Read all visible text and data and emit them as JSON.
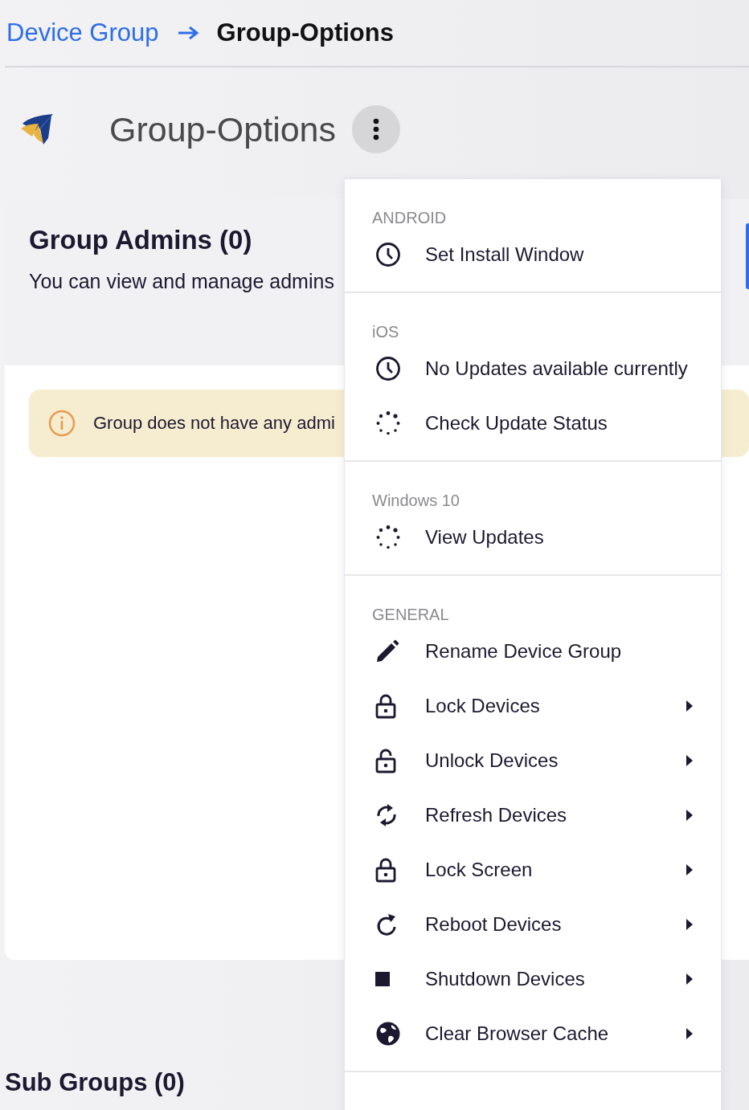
{
  "breadcrumb": {
    "parent": "Device Group",
    "current": "Group-Options"
  },
  "header": {
    "title": "Group-Options"
  },
  "admins_card": {
    "title": "Group Admins (0)",
    "description": "You can view and manage admins",
    "alert": "Group does not have any admi"
  },
  "sub_groups": {
    "title": "Sub Groups (0)"
  },
  "menu": {
    "sections": [
      {
        "heading": "ANDROID",
        "items": [
          {
            "label": "Set Install Window",
            "kind": "clock",
            "submenu": false
          }
        ]
      },
      {
        "heading": "iOS",
        "items": [
          {
            "label": "No Updates available currently",
            "kind": "clock",
            "submenu": false
          },
          {
            "label": "Check Update Status",
            "kind": "spinner",
            "submenu": false
          }
        ]
      },
      {
        "heading": "Windows 10",
        "items": [
          {
            "label": "View Updates",
            "kind": "spinner",
            "submenu": false
          }
        ]
      },
      {
        "heading": "GENERAL",
        "items": [
          {
            "label": "Rename Device Group",
            "kind": "pencil",
            "submenu": false
          },
          {
            "label": "Lock Devices",
            "kind": "lock",
            "submenu": true
          },
          {
            "label": "Unlock Devices",
            "kind": "unlock",
            "submenu": true
          },
          {
            "label": "Refresh Devices",
            "kind": "sync",
            "submenu": true
          },
          {
            "label": "Lock Screen",
            "kind": "lock",
            "submenu": true
          },
          {
            "label": "Reboot Devices",
            "kind": "redo",
            "submenu": true
          },
          {
            "label": "Shutdown Devices",
            "kind": "stop",
            "submenu": true
          },
          {
            "label": "Clear Browser Cache",
            "kind": "globe",
            "submenu": true
          }
        ]
      }
    ]
  }
}
